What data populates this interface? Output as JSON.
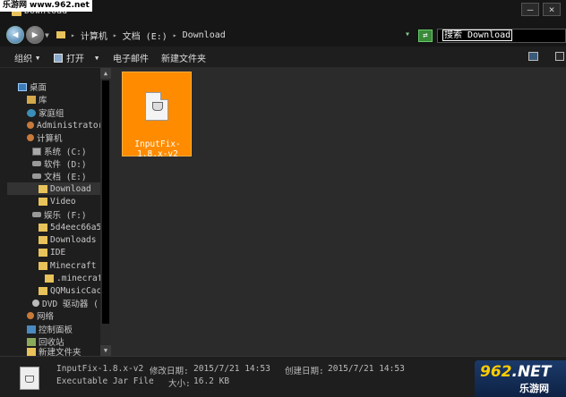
{
  "watermark": {
    "site": "乐游网",
    "url": "www.962.net"
  },
  "window": {
    "title": "Download",
    "controls": {
      "minimize": "–",
      "close": "×"
    }
  },
  "address": {
    "segments": [
      "计算机",
      "文档 (E:)",
      "Download"
    ],
    "search_placeholder": "搜索 Download"
  },
  "toolbar": {
    "organize": "组织",
    "open": "打开",
    "email": "电子邮件",
    "new_folder": "新建文件夹"
  },
  "sidebar": {
    "items": [
      {
        "label": "桌面",
        "icon": "desktop-icon"
      },
      {
        "label": "库",
        "icon": "library-icon"
      },
      {
        "label": "家庭组",
        "icon": "homegroup-icon"
      },
      {
        "label": "Administrator",
        "icon": "user-icon"
      },
      {
        "label": "计算机",
        "icon": "computer-icon"
      },
      {
        "label": "系统 (C:)",
        "icon": "drive-icon"
      },
      {
        "label": "软件 (D:)",
        "icon": "drive-icon"
      },
      {
        "label": "文档 (E:)",
        "icon": "drive-icon"
      },
      {
        "label": "Download",
        "icon": "folder-icon",
        "selected": true
      },
      {
        "label": "Video",
        "icon": "folder-icon"
      },
      {
        "label": "娱乐 (F:)",
        "icon": "drive-icon"
      },
      {
        "label": "5d4eec66a5",
        "icon": "folder-icon"
      },
      {
        "label": "Downloads",
        "icon": "folder-icon"
      },
      {
        "label": "IDE",
        "icon": "folder-icon"
      },
      {
        "label": "Minecraft",
        "icon": "folder-icon"
      },
      {
        "label": ".minecraf",
        "icon": "folder-icon"
      },
      {
        "label": "QQMusicCac",
        "icon": "folder-icon"
      },
      {
        "label": "DVD 驱动器 (",
        "icon": "dvd-icon"
      },
      {
        "label": "网络",
        "icon": "network-icon"
      },
      {
        "label": "控制面板",
        "icon": "control-panel-icon"
      },
      {
        "label": "回收站",
        "icon": "recycle-bin-icon"
      },
      {
        "label": "新建文件夹",
        "icon": "folder-icon"
      }
    ]
  },
  "file": {
    "name": "InputFix-1.8.x-v2",
    "type": "Executable Jar File"
  },
  "details": {
    "name": "InputFix-1.8.x-v2",
    "type": "Executable Jar File",
    "modified_label": "修改日期:",
    "modified": "2015/7/21 14:53",
    "created_label": "创建日期:",
    "created": "2015/7/21 14:53",
    "size_label": "大小:",
    "size": "16.2 KB"
  },
  "logo": {
    "main": "962",
    "dot": ".NET",
    "sub": "乐游网"
  },
  "colors": {
    "accent": "#ff8c00",
    "background": "#1e1e1e",
    "content": "#2b2b2b"
  }
}
